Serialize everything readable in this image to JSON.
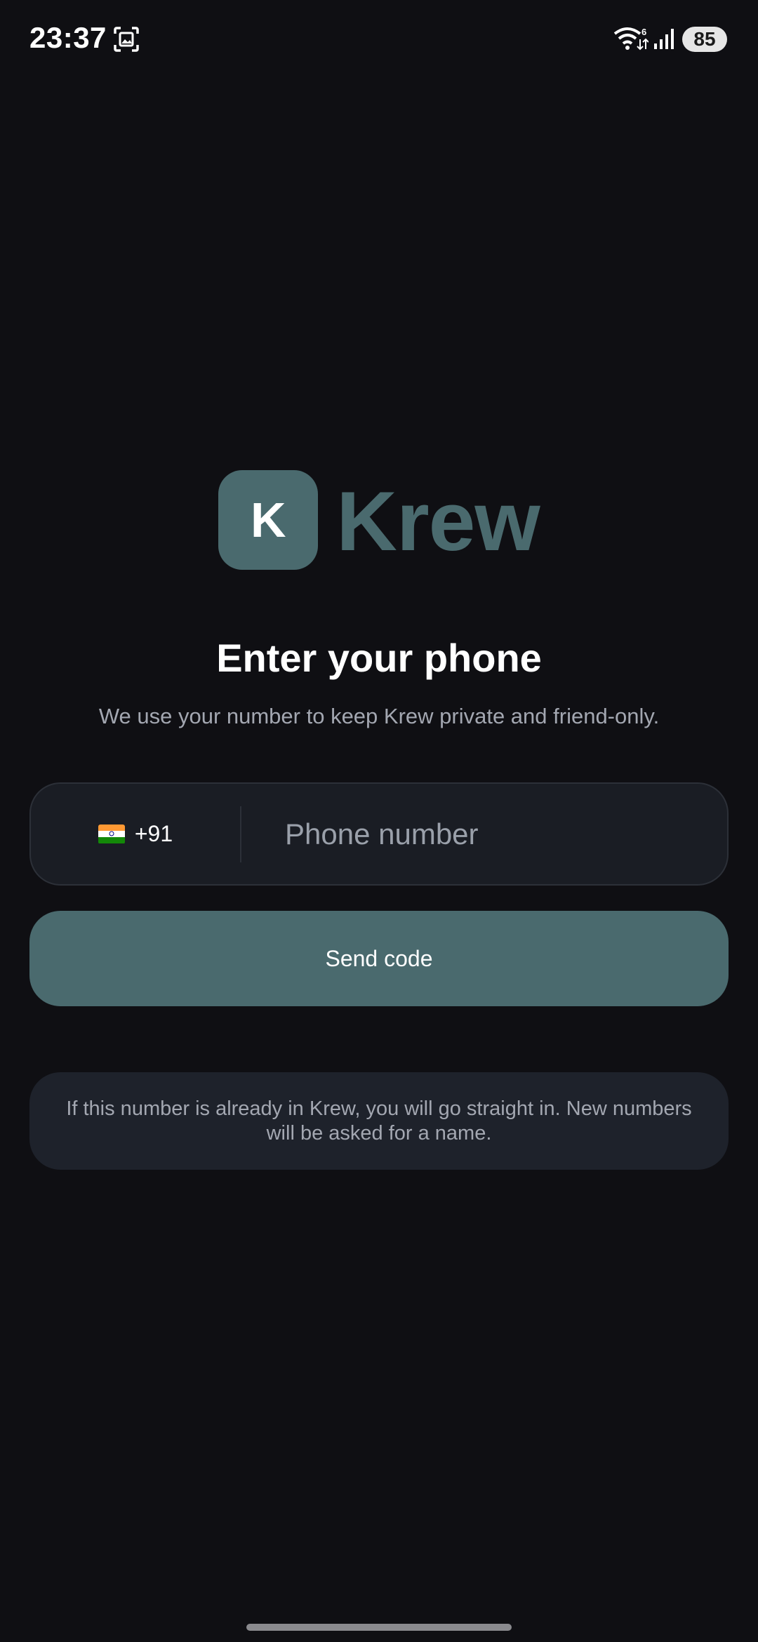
{
  "status_bar": {
    "time": "23:37",
    "battery": "85",
    "icons": [
      "screenshot-icon",
      "wifi-icon",
      "signal-icon",
      "battery-icon"
    ]
  },
  "logo": {
    "initial": "K",
    "wordmark": "Krew"
  },
  "heading": {
    "title": "Enter your phone",
    "subtitle": "We use your number to keep Krew private and friend-only."
  },
  "phone_field": {
    "country_flag": "india-flag-icon",
    "dial_code": "+91",
    "placeholder": "Phone number",
    "value": ""
  },
  "send_button": {
    "label": "Send code"
  },
  "info": {
    "text": "If this number is already in Krew, you will go straight in. New numbers will be asked for a name."
  },
  "colors": {
    "background": "#0f0f13",
    "accent": "#4a6a6e",
    "field_bg": "#1a1d24",
    "card_bg": "#1e222b",
    "muted_text": "#a3a7b1"
  }
}
